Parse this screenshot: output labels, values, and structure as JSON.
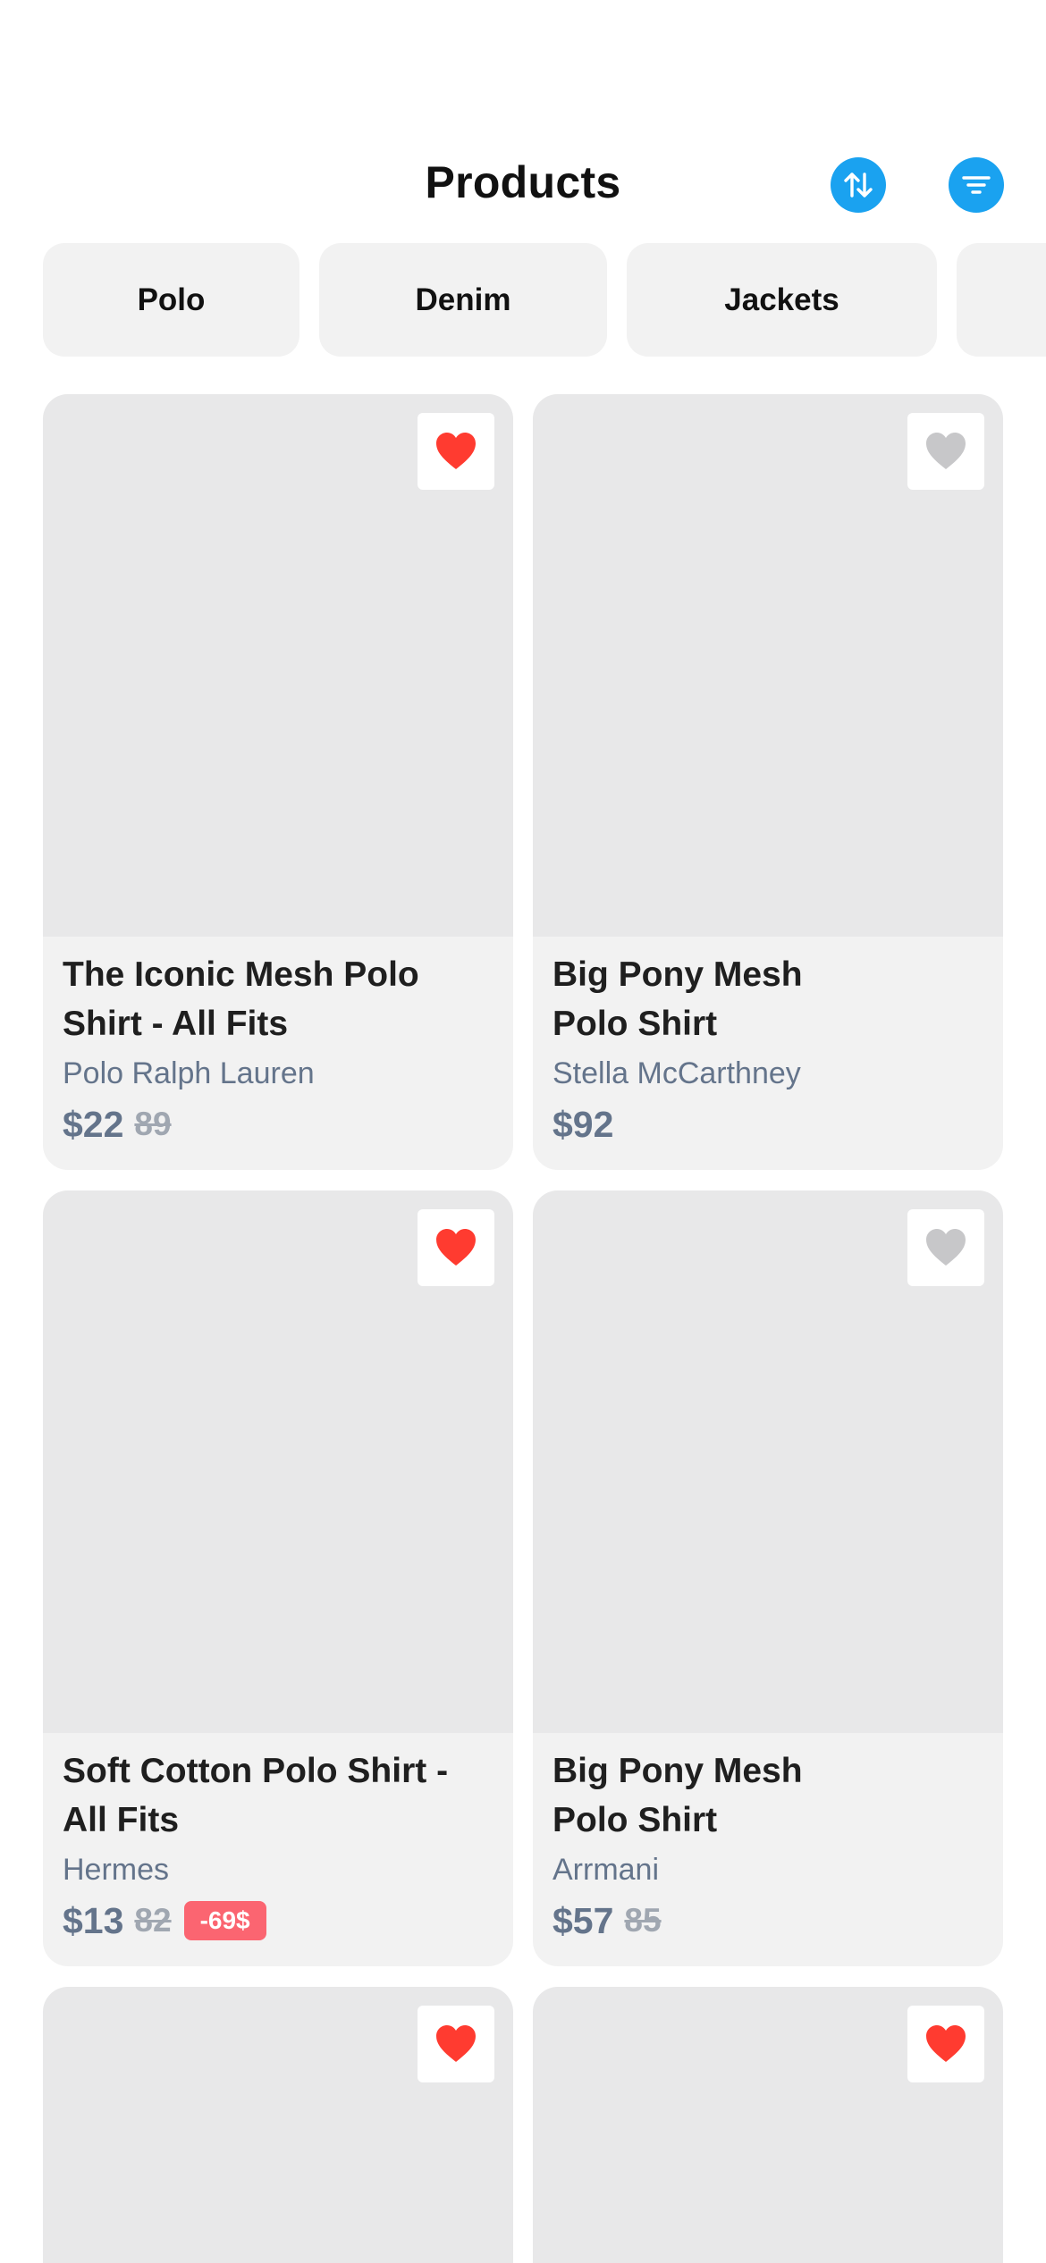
{
  "header": {
    "title": "Products"
  },
  "categories": [
    "Polo",
    "Denim",
    "Jackets"
  ],
  "colors": {
    "accent": "#1aa2f0",
    "fav_on": "#ff3b30",
    "fav_off": "#c7c7c9",
    "badge": "#fb6571"
  },
  "products": [
    {
      "name": "The Iconic Mesh Polo\nShirt - All Fits",
      "brand": "Polo Ralph Lauren",
      "price": "$22",
      "old_price": "89",
      "discount": "",
      "favorite": true
    },
    {
      "name": "Big Pony Mesh\nPolo Shirt",
      "brand": "Stella McCarthney",
      "price": "$92",
      "old_price": "",
      "discount": "",
      "favorite": false
    },
    {
      "name": "Soft Cotton Polo Shirt -\nAll Fits",
      "brand": "Hermes",
      "price": "$13",
      "old_price": "82",
      "discount": "-69$",
      "favorite": true
    },
    {
      "name": "Big Pony Mesh\nPolo Shirt",
      "brand": "Arrmani",
      "price": "$57",
      "old_price": "85",
      "discount": "",
      "favorite": false
    },
    {
      "name": "",
      "brand": "",
      "price": "",
      "old_price": "",
      "discount": "",
      "favorite": true
    },
    {
      "name": "",
      "brand": "",
      "price": "",
      "old_price": "",
      "discount": "",
      "favorite": true
    }
  ]
}
